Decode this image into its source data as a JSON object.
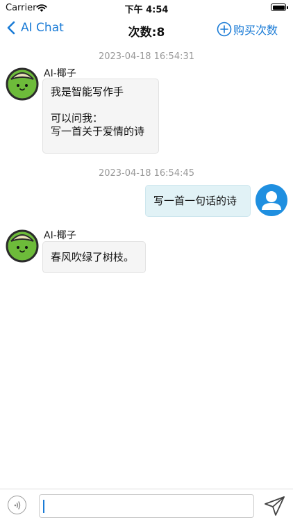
{
  "status_bar": {
    "carrier": "Carrier",
    "time": "下午 4:54"
  },
  "nav": {
    "back_label": "AI Chat",
    "title": "次数:8",
    "buy_label": "购买次数"
  },
  "messages": [
    {
      "timestamp": "2023-04-18 16:54:31",
      "sender": "AI-椰子",
      "lines": [
        "我是智能写作手",
        "",
        "可以问我：",
        "写一首关于爱情的诗"
      ]
    },
    {
      "timestamp": "2023-04-18 16:54:45",
      "text": "写一首一句话的诗"
    },
    {
      "sender": "AI-椰子",
      "text": "春风吹绿了树枝。"
    }
  ],
  "composer": {
    "value": "",
    "placeholder": ""
  },
  "colors": {
    "accent": "#1a7bd6",
    "user_avatar": "#1f8fe0",
    "ai_avatar_body": "#6dbb3a",
    "ai_bubble": "#f5f5f5",
    "user_bubble": "#e1f2f6"
  }
}
